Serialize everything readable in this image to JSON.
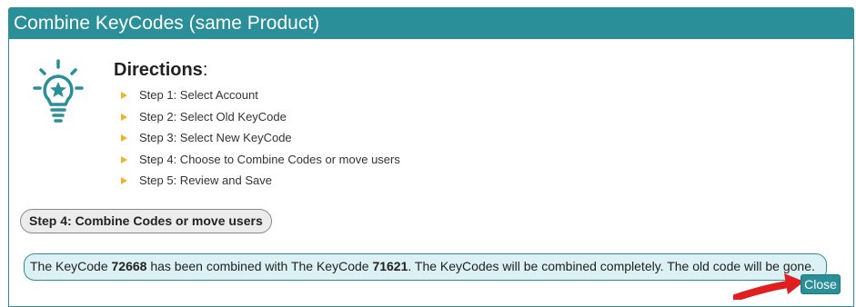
{
  "dialog": {
    "title": "Combine KeyCodes (same Product)",
    "directions_title": "Directions",
    "directions_colon": ":",
    "icon": "lightbulb-star-icon",
    "steps": [
      "Step 1: Select Account",
      "Step 2: Select Old KeyCode",
      "Step 3: Select New KeyCode",
      "Step 4: Choose to Combine Codes or move users",
      "Step 5: Review and Save"
    ],
    "current_step_label": "Step 4: Combine Codes or move users",
    "message": {
      "part1": "The KeyCode ",
      "old_code": "72668",
      "part2": " has been combined with The KeyCode ",
      "new_code": "71621",
      "part3": ". The KeyCodes will be combined completely. The old code will be gone."
    },
    "close_label": "Close"
  },
  "colors": {
    "accent": "#2a8f98",
    "bullet": "#f0b429",
    "message_bg": "#dcf1f4",
    "pointer": "#e02020"
  }
}
